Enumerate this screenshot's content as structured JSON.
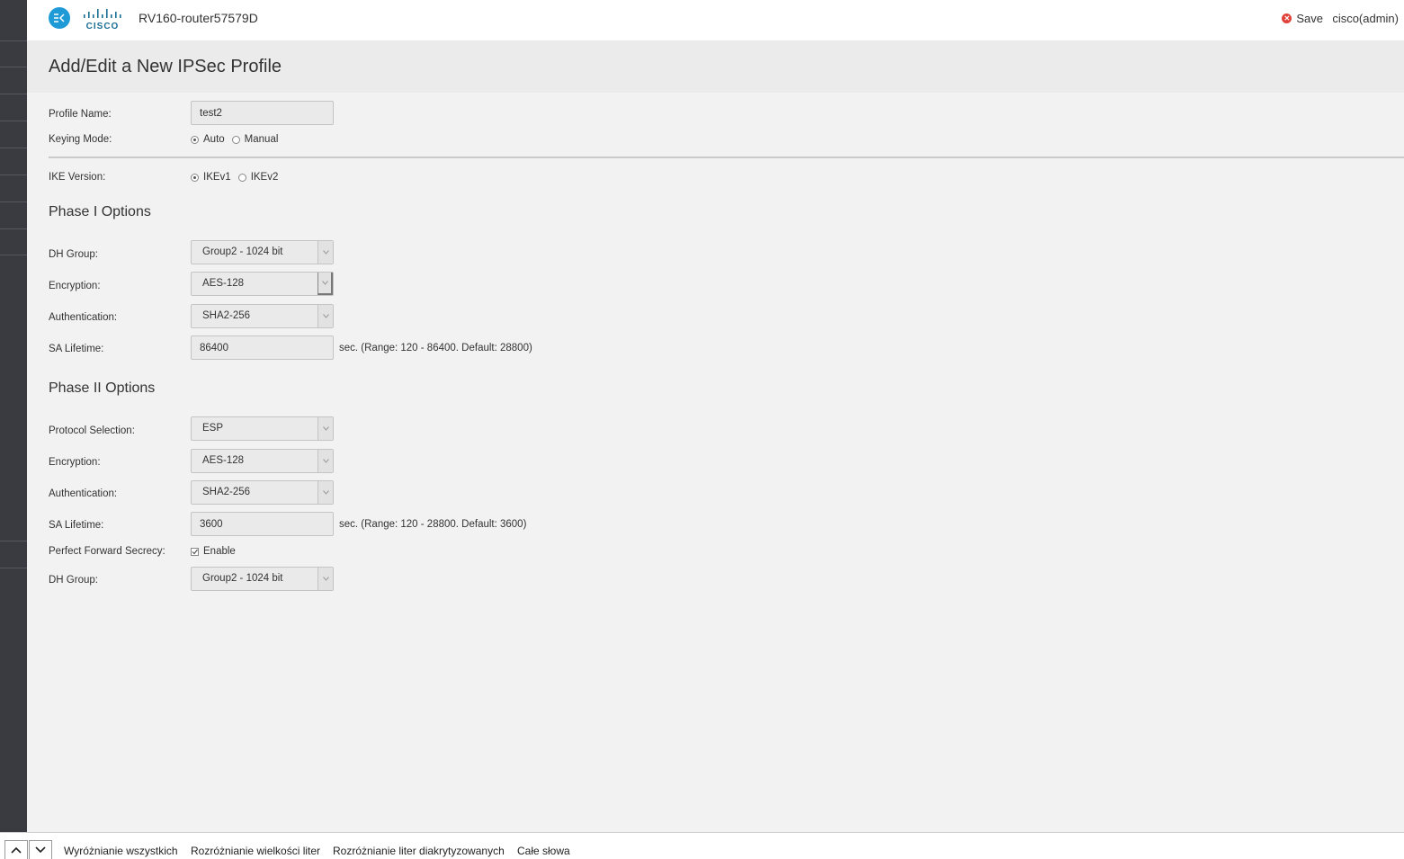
{
  "header": {
    "device_name": "RV160-router57579D",
    "save_label": "Save",
    "user_label": "cisco(admin)"
  },
  "page_title": "Add/Edit a New IPSec Profile",
  "profile": {
    "name_label": "Profile Name:",
    "name_value": "test2",
    "keying_label": "Keying Mode:",
    "keying_options": [
      "Auto",
      "Manual"
    ],
    "keying_selected": "Auto",
    "ike_label": "IKE Version:",
    "ike_options": [
      "IKEv1",
      "IKEv2"
    ],
    "ike_selected": "IKEv1"
  },
  "phase1": {
    "title": "Phase I Options",
    "dh_label": "DH Group:",
    "dh_value": "Group2 - 1024 bit",
    "enc_label": "Encryption:",
    "enc_value": "AES-128",
    "auth_label": "Authentication:",
    "auth_value": "SHA2-256",
    "sa_label": "SA Lifetime:",
    "sa_value": "86400",
    "sa_hint": "sec. (Range: 120 - 86400. Default: 28800)"
  },
  "phase2": {
    "title": "Phase II Options",
    "proto_label": "Protocol Selection:",
    "proto_value": "ESP",
    "enc_label": "Encryption:",
    "enc_value": "AES-128",
    "auth_label": "Authentication:",
    "auth_value": "SHA2-256",
    "sa_label": "SA Lifetime:",
    "sa_value": "3600",
    "sa_hint": "sec. (Range: 120 - 28800. Default: 3600)",
    "pfs_label": "Perfect Forward Secrecy:",
    "pfs_option": "Enable",
    "pfs_checked": true,
    "dh_label": "DH Group:",
    "dh_value": "Group2 - 1024 bit"
  },
  "findbar": {
    "options": [
      "Wyróżnianie wszystkich",
      "Rozróżnianie wielkości liter",
      "Rozróżnianie liter diakrytyzowanych",
      "Całe słowa"
    ]
  },
  "colors": {
    "accent": "#1e9ad6",
    "sidebar": "#393b40",
    "save_icon": "#e0423a"
  }
}
